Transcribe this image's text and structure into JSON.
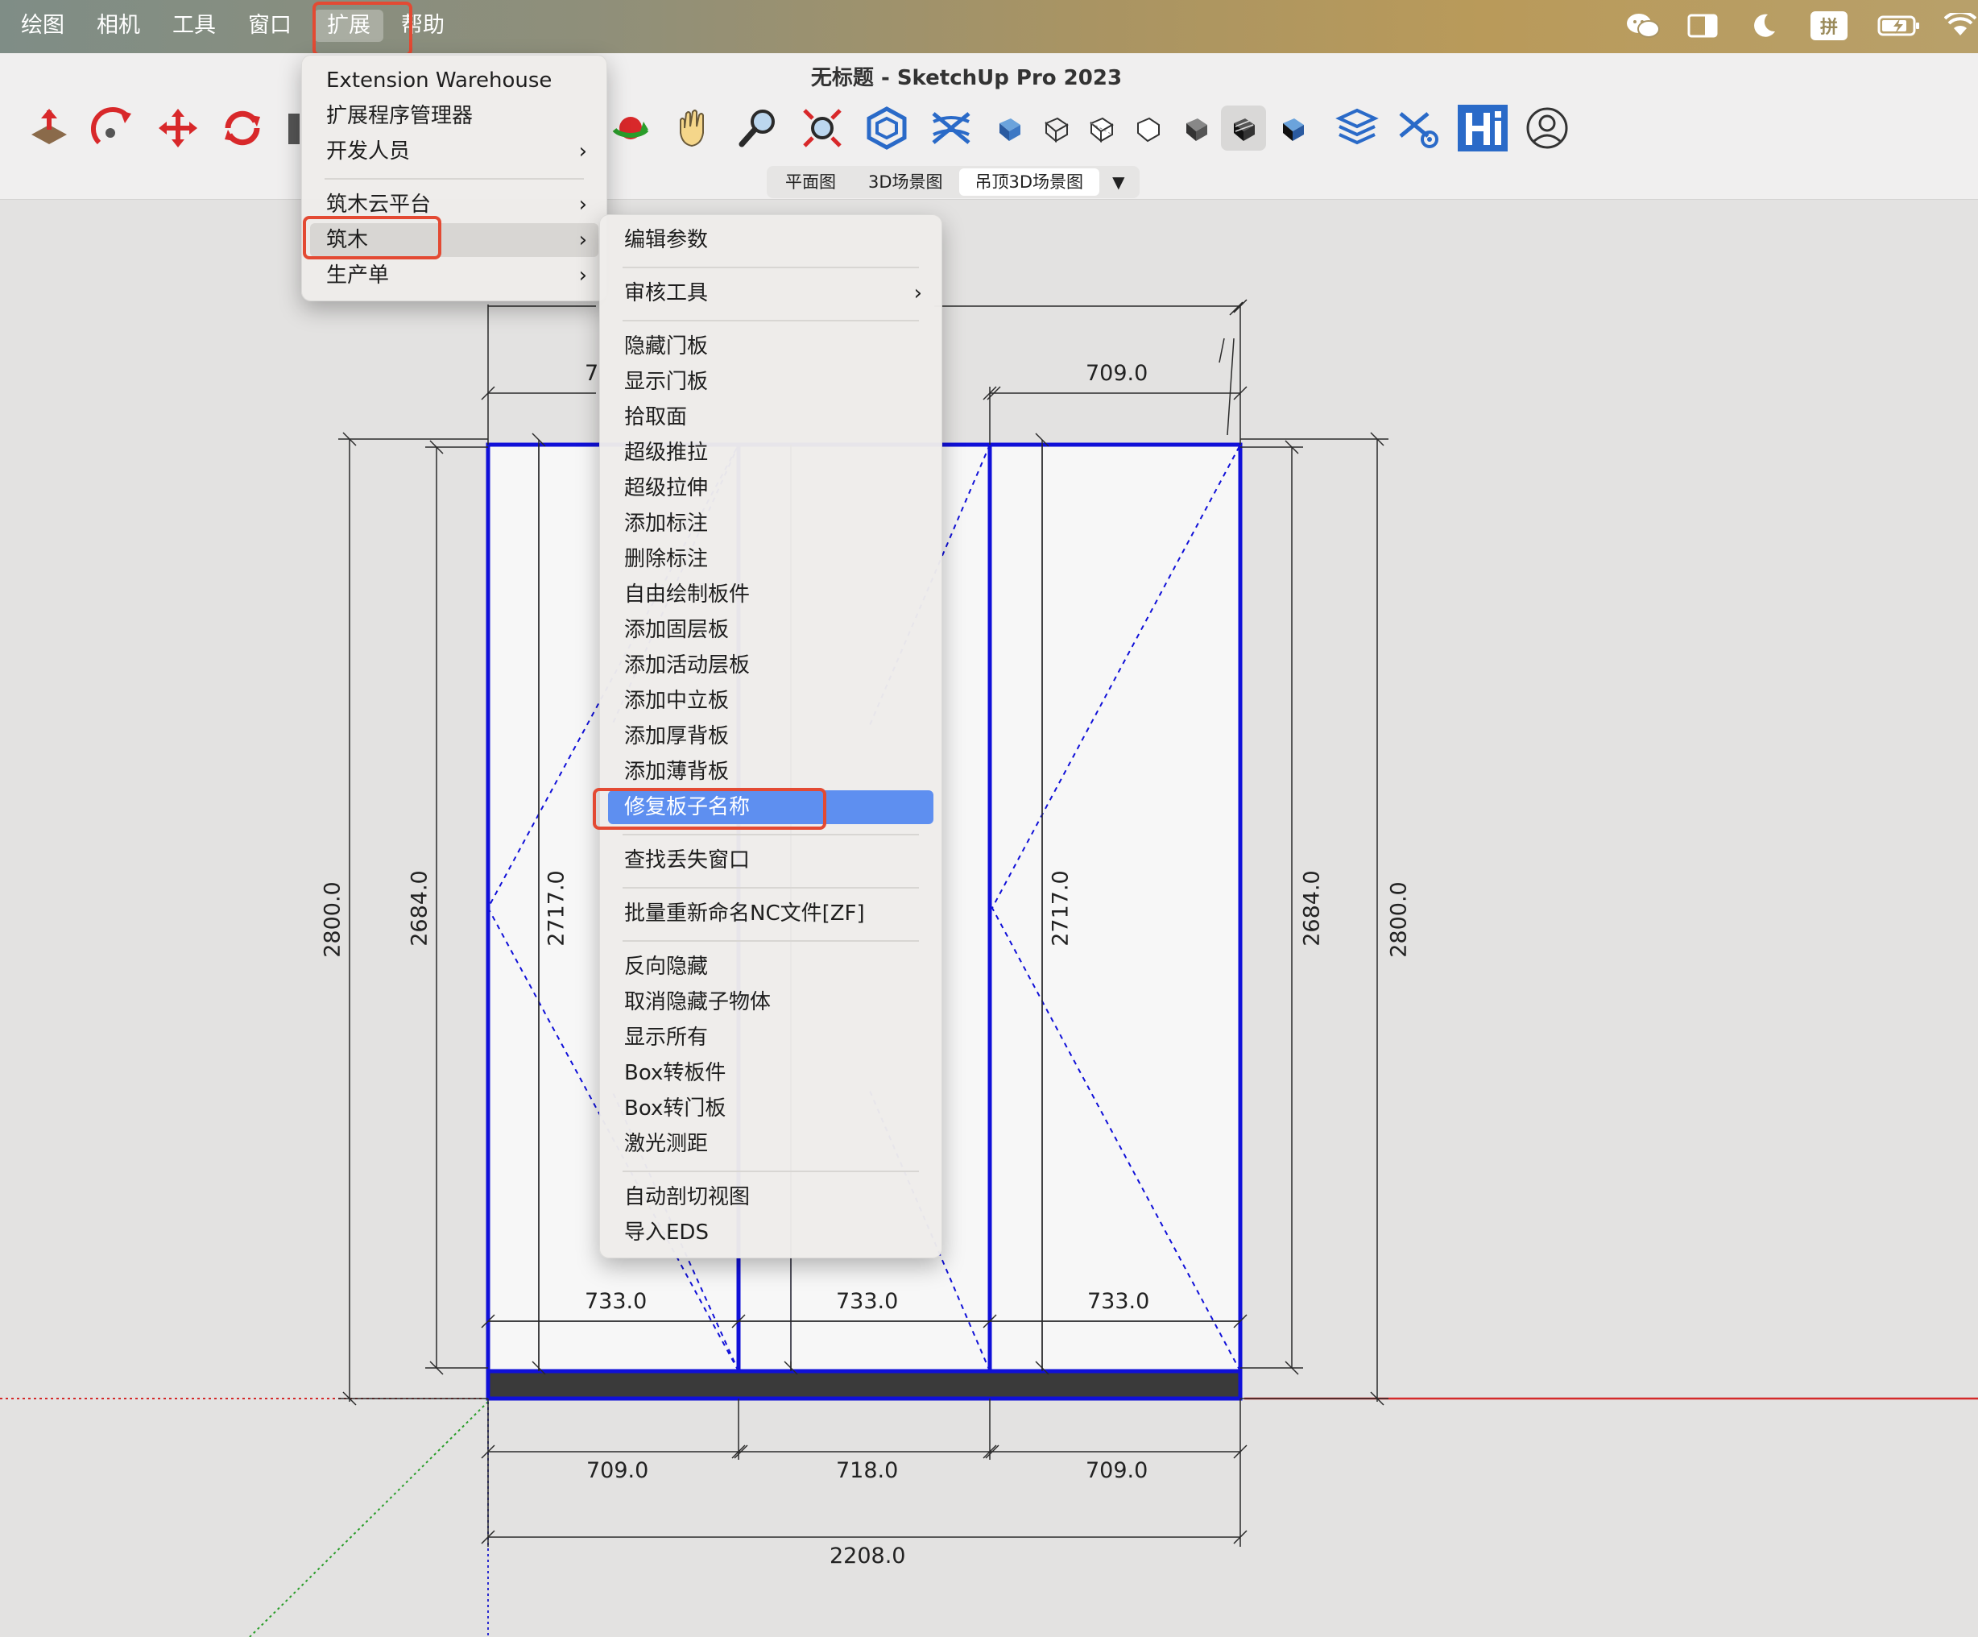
{
  "mac_menubar": {
    "items": [
      "绘图",
      "相机",
      "工具",
      "窗口",
      "扩展",
      "帮助"
    ],
    "status_icons": [
      "wechat-icon",
      "sidebar-icon",
      "moon-icon",
      "input-method-icon",
      "battery-icon",
      "wifi-icon"
    ],
    "input_method_label": "拼"
  },
  "window": {
    "title": "无标题 - SketchUp Pro 2023"
  },
  "scenes": {
    "tabs": [
      "平面图",
      "3D场景图",
      "吊顶3D场景图"
    ],
    "selected": "吊顶3D场景图",
    "more": "▼"
  },
  "extensions_menu": {
    "items": [
      {
        "label": "Extension Warehouse"
      },
      {
        "label": "扩展程序管理器"
      },
      {
        "label": "开发人员",
        "submenu": true
      },
      {
        "label": "筑木云平台",
        "submenu": true
      },
      {
        "label": "筑木",
        "submenu": true,
        "highlighted": true
      },
      {
        "label": "生产单",
        "submenu": true
      }
    ]
  },
  "zhumu_submenu": {
    "items": [
      {
        "label": "编辑参数"
      },
      {
        "label": "审核工具",
        "submenu": true
      },
      {
        "label": "隐藏门板"
      },
      {
        "label": "显示门板"
      },
      {
        "label": "拾取面"
      },
      {
        "label": "超级推拉"
      },
      {
        "label": "超级拉伸"
      },
      {
        "label": "添加标注"
      },
      {
        "label": "删除标注"
      },
      {
        "label": "自由绘制板件"
      },
      {
        "label": "添加固层板"
      },
      {
        "label": "添加活动层板"
      },
      {
        "label": "添加中立板"
      },
      {
        "label": "添加厚背板"
      },
      {
        "label": "添加薄背板"
      },
      {
        "label": "修复板子名称",
        "highlighted": true
      },
      {
        "label": "查找丢失窗口"
      },
      {
        "label": "批量重新命名NC文件[ZF]"
      },
      {
        "label": "反向隐藏"
      },
      {
        "label": "取消隐藏子物体"
      },
      {
        "label": "显示所有"
      },
      {
        "label": "Box转板件"
      },
      {
        "label": "Box转门板"
      },
      {
        "label": "激光测距"
      },
      {
        "label": "自动剖切视图"
      },
      {
        "label": "导入EDS"
      }
    ]
  },
  "drawing": {
    "dimensions": {
      "top_partial": "7",
      "top_right": "709.0",
      "inner_widths": [
        "733.0",
        "733.0",
        "733.0"
      ],
      "bottom_widths": [
        "709.0",
        "718.0",
        "709.0"
      ],
      "total_width": "2208.0",
      "left_heights": [
        "2800.0",
        "2684.0",
        "2717.0"
      ],
      "right_heights": [
        "2717.0",
        "2684.0",
        "2800.0"
      ]
    }
  },
  "colors": {
    "highlight": "#5e8ff0",
    "annotation_red": "#e34a33",
    "cabinet_blue": "#1010d8",
    "axis_red": "#d42a2a",
    "axis_green": "#2a9d2a"
  }
}
